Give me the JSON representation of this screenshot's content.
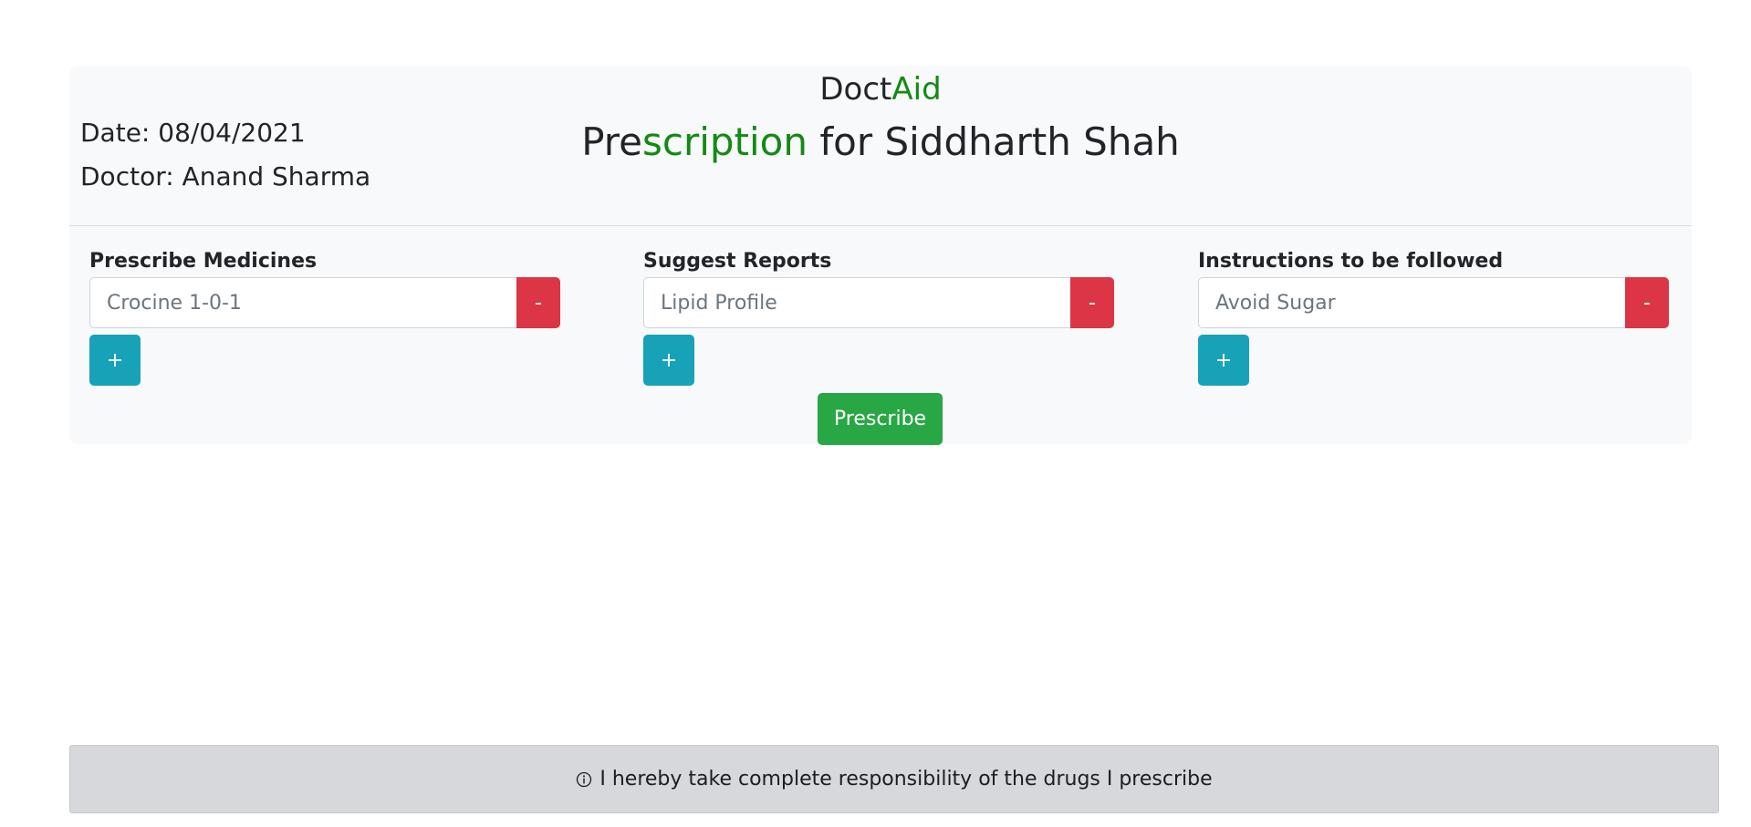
{
  "brand": {
    "part1": "Doct",
    "part2": "Aid"
  },
  "header": {
    "title_part1": "Pre",
    "title_part2": "scription",
    "title_part3": " for Siddharth Shah",
    "date": "Date: 08/04/2021",
    "doctor": "Doctor: Anand Sharma"
  },
  "columns": [
    {
      "label": "Prescribe Medicines",
      "placeholder": "Crocine 1-0-1",
      "remove_label": "-",
      "add_label": "+"
    },
    {
      "label": "Suggest Reports",
      "placeholder": "Lipid Profile",
      "remove_label": "-",
      "add_label": "+"
    },
    {
      "label": "Instructions to be followed",
      "placeholder": "Avoid Sugar",
      "remove_label": "-",
      "add_label": "+"
    }
  ],
  "actions": {
    "prescribe_label": "Prescribe"
  },
  "footer": {
    "icon": "info-icon",
    "text": "I hereby take complete responsibility of the drugs I prescribe"
  },
  "colors": {
    "accent": "#138a13",
    "danger": "#dc3545",
    "info": "#17a2b8",
    "success": "#28a745"
  }
}
